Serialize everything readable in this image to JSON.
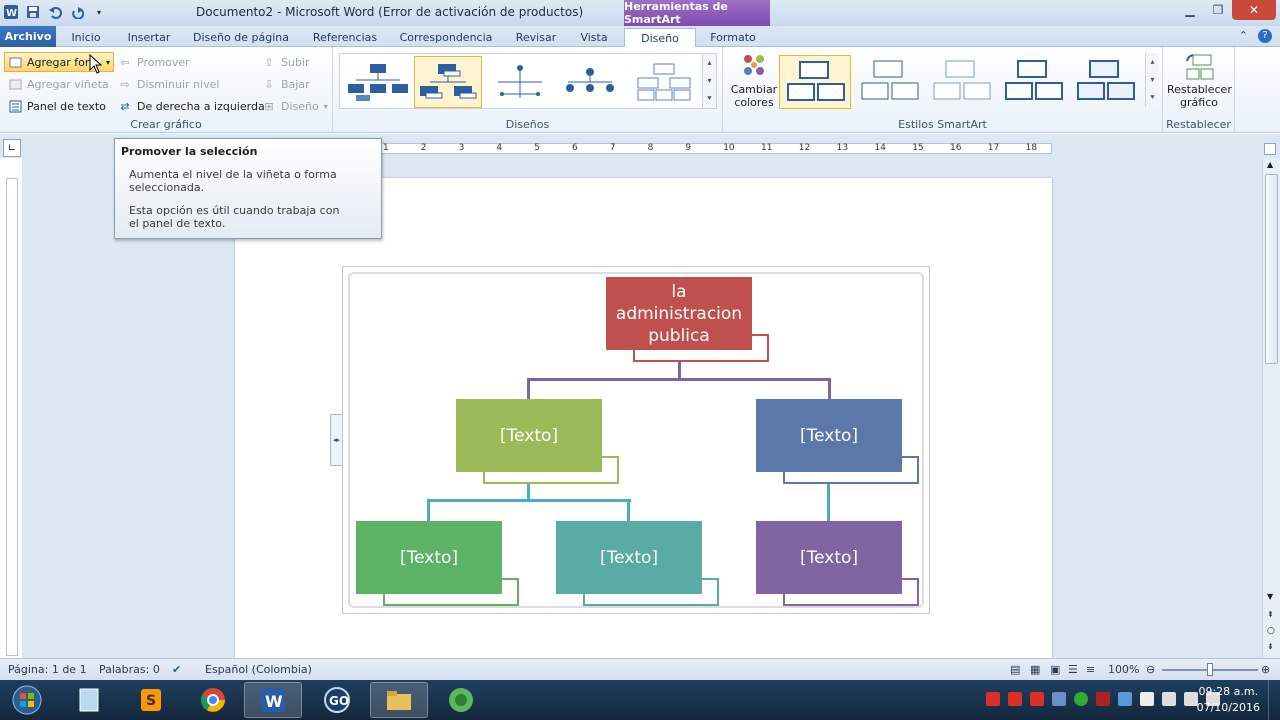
{
  "title_bar": {
    "document_title": "Documento2 - Microsoft Word (Error de activación de productos)",
    "context_tab_header": "Herramientas de SmartArt"
  },
  "tabs": [
    {
      "label": "Archivo"
    },
    {
      "label": "Inicio"
    },
    {
      "label": "Insertar"
    },
    {
      "label": "Diseño de página"
    },
    {
      "label": "Referencias"
    },
    {
      "label": "Correspondencia"
    },
    {
      "label": "Revisar"
    },
    {
      "label": "Vista"
    },
    {
      "label": "Diseño"
    },
    {
      "label": "Formato"
    }
  ],
  "ribbon": {
    "create_graphic": {
      "label": "Crear gráfico",
      "add_shape": "Agregar forma",
      "add_bullet": "Agregar viñeta",
      "text_pane": "Panel de texto",
      "promote": "Promover",
      "demote": "Disminuir nivel",
      "right_to_left": "De derecha a izquierda",
      "move_up": "Subir",
      "move_down": "Bajar",
      "layout": "Diseño"
    },
    "layouts": {
      "label": "Diseños"
    },
    "styles": {
      "label": "Estilos SmartArt",
      "change_colors": "Cambiar colores"
    },
    "reset": {
      "label": "Restablecer",
      "reset_graphic": "Restablecer gráfico"
    }
  },
  "tooltip": {
    "title": "Promover la selección",
    "line1": "Aumenta el nivel de la viñeta o forma seleccionada.",
    "line2": "Esta opción es útil cuando trabaja con el panel de texto."
  },
  "ruler": {
    "numbers": [
      "1",
      "2",
      "3",
      "4",
      "5",
      "6",
      "7",
      "8",
      "9",
      "10",
      "11",
      "12",
      "13",
      "14",
      "15",
      "16",
      "17",
      "18"
    ]
  },
  "smartart": {
    "nodes": [
      {
        "text": "la administracion publica",
        "color": "#c0504d"
      },
      {
        "text": "[Texto]",
        "color": "#9bbb59"
      },
      {
        "text": "[Texto]",
        "color": "#5a78aa"
      },
      {
        "text": "[Texto]",
        "color": "#5cb365"
      },
      {
        "text": "[Texto]",
        "color": "#5aaaa5"
      },
      {
        "text": "[Texto]",
        "color": "#8064a2"
      }
    ]
  },
  "status_bar": {
    "page": "Página: 1 de 1",
    "words": "Palabras: 0",
    "language": "Español (Colombia)",
    "zoom": "100%"
  },
  "taskbar": {
    "time": "09:28 a.m.",
    "date": "07/10/2016"
  }
}
